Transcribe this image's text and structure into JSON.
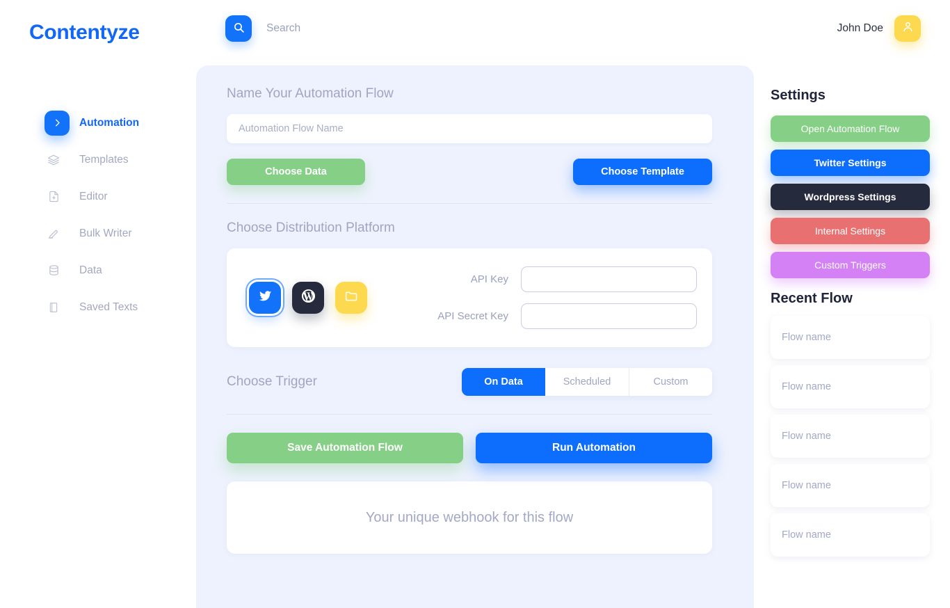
{
  "header": {
    "brand": "Contentyze",
    "search": {
      "icon": "search-icon",
      "placeholder": "Search"
    },
    "user": {
      "name": "John Doe",
      "avatar_icon": "user-icon"
    }
  },
  "sidebar": {
    "items": [
      {
        "label": "Automation",
        "icon": "chevron-right-icon",
        "active": true
      },
      {
        "label": "Templates",
        "icon": "layers-icon",
        "active": false
      },
      {
        "label": "Editor",
        "icon": "document-add-icon",
        "active": false
      },
      {
        "label": "Bulk Writer",
        "icon": "pen-icon",
        "active": false
      },
      {
        "label": "Data",
        "icon": "database-icon",
        "active": false
      },
      {
        "label": "Saved Texts",
        "icon": "book-icon",
        "active": false
      }
    ]
  },
  "main": {
    "name_section": {
      "title": "Name Your Automation Flow",
      "input_placeholder": "Automation Flow Name",
      "input_value": "",
      "choose_data_label": "Choose Data",
      "choose_template_label": "Choose Template"
    },
    "platform_section": {
      "title": "Choose Distribution Platform",
      "platforms": [
        {
          "name": "twitter",
          "icon": "twitter-icon",
          "selected": true
        },
        {
          "name": "wordpress",
          "icon": "wordpress-icon",
          "selected": false
        },
        {
          "name": "folder",
          "icon": "folder-icon",
          "selected": false
        }
      ],
      "api_key_label": "API Key",
      "api_key_value": "",
      "api_secret_label": "API Secret Key",
      "api_secret_value": ""
    },
    "trigger_section": {
      "title": "Choose Trigger",
      "options": [
        {
          "label": "On Data",
          "active": true
        },
        {
          "label": "Scheduled",
          "active": false
        },
        {
          "label": "Custom",
          "active": false
        }
      ]
    },
    "actions": {
      "save_label": "Save Automation Flow",
      "run_label": "Run Automation"
    },
    "webhook_text": "Your unique webhook for this flow"
  },
  "right": {
    "settings_title": "Settings",
    "settings_buttons": [
      {
        "label": "Open Automation Flow",
        "color": "#86cf86"
      },
      {
        "label": "Twitter Settings",
        "color": "#0d6efd"
      },
      {
        "label": "Wordpress Settings",
        "color": "#262a3d"
      },
      {
        "label": "Internal Settings",
        "color": "#e97070"
      },
      {
        "label": "Custom Triggers",
        "color": "#d481f5"
      }
    ],
    "recent_title": "Recent Flow",
    "recent_flows": [
      {
        "label": "Flow name"
      },
      {
        "label": "Flow name"
      },
      {
        "label": "Flow name"
      },
      {
        "label": "Flow name"
      },
      {
        "label": "Flow name"
      }
    ]
  }
}
